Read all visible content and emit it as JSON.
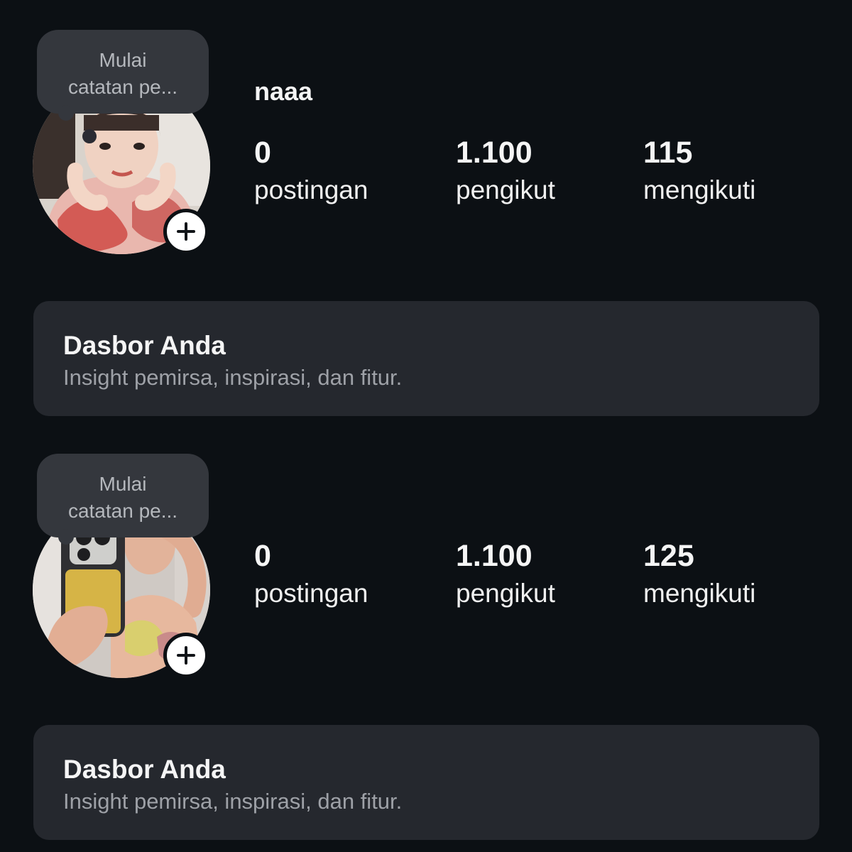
{
  "profiles": [
    {
      "note": {
        "line1": "Mulai",
        "line2": "catatan pe..."
      },
      "username": "naaa",
      "stats": {
        "posts": {
          "value": "0",
          "label": "postingan"
        },
        "followers": {
          "value": "1.100",
          "label": "pengikut"
        },
        "following": {
          "value": "115",
          "label": "mengikuti"
        }
      },
      "dashboard": {
        "title": "Dasbor Anda",
        "subtitle": "Insight pemirsa, inspirasi, dan fitur."
      }
    },
    {
      "note": {
        "line1": "Mulai",
        "line2": "catatan pe..."
      },
      "stats": {
        "posts": {
          "value": "0",
          "label": "postingan"
        },
        "followers": {
          "value": "1.100",
          "label": "pengikut"
        },
        "following": {
          "value": "125",
          "label": "mengikuti"
        }
      },
      "dashboard": {
        "title": "Dasbor Anda",
        "subtitle": "Insight pemirsa, inspirasi, dan fitur."
      }
    }
  ],
  "icons": {
    "add_story": "plus-icon"
  },
  "colors": {
    "background": "#0c1014",
    "card": "#25282e",
    "note_bubble": "#34373d",
    "text_primary": "#f5f5f5",
    "text_secondary": "#9ea1a7"
  }
}
